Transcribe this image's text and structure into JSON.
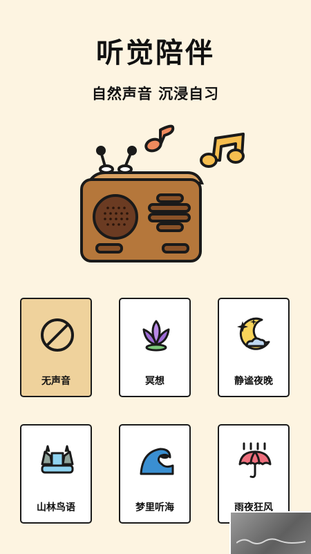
{
  "header": {
    "title": "听觉陪伴",
    "subtitle": "自然声音 沉浸自习"
  },
  "cards": [
    {
      "label": "无声音",
      "icon": "mute-icon",
      "selected": true
    },
    {
      "label": "冥想",
      "icon": "lotus-icon",
      "selected": false
    },
    {
      "label": "静谧夜晚",
      "icon": "moon-icon",
      "selected": false
    },
    {
      "label": "山林鸟语",
      "icon": "waterfall-icon",
      "selected": false
    },
    {
      "label": "梦里听海",
      "icon": "wave-icon",
      "selected": false
    },
    {
      "label": "雨夜狂风",
      "icon": "rain-umbrella-icon",
      "selected": false
    }
  ],
  "colors": {
    "background": "#FDF4E1",
    "selected_card": "#EFD29C",
    "radio_wood": "#B5773B",
    "note_orange": "#F08A5D",
    "note_yellow": "#F6BE4F"
  }
}
